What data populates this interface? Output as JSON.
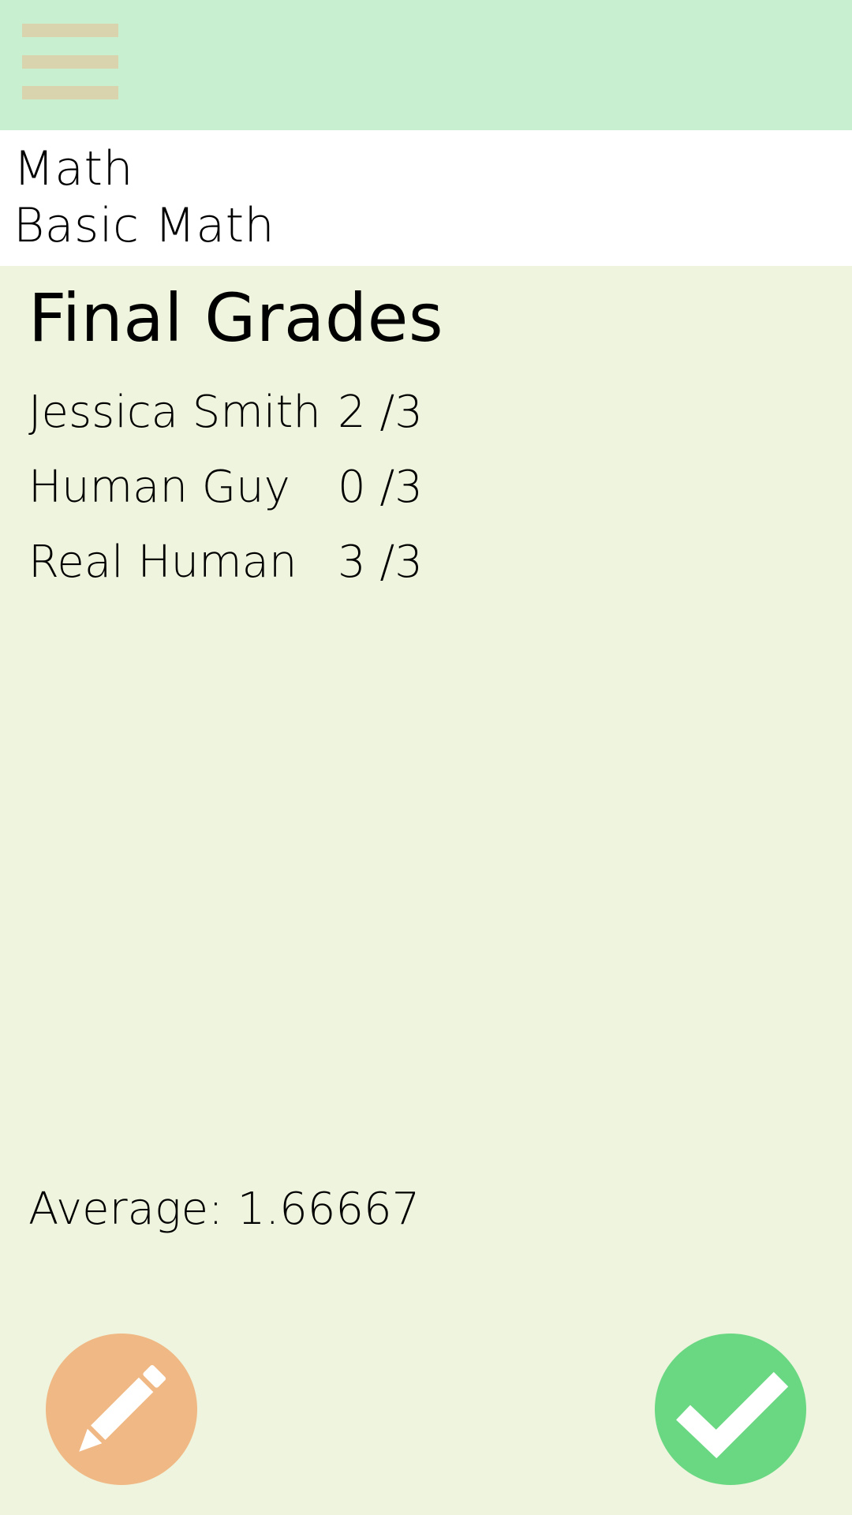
{
  "course": {
    "subject": "Math",
    "name": "Basic Math"
  },
  "page": {
    "title": "Final Grades"
  },
  "grades": [
    {
      "student": "Jessica Smith",
      "score": "2 /3"
    },
    {
      "student": "Human Guy",
      "score": "0 /3"
    },
    {
      "student": "Real Human",
      "score": "3 /3"
    }
  ],
  "summary": {
    "average_text": "Average: 1.66667"
  },
  "actions": {
    "menu_icon": "hamburger-menu-icon",
    "edit_icon": "pencil-icon",
    "confirm_icon": "checkmark-icon"
  },
  "colors": {
    "appbar": "#c8efd0",
    "background": "#eef4dd",
    "edit_fab": "#f0b884",
    "confirm_fab": "#6ad882",
    "menu_icon": "#d9d4ad"
  }
}
